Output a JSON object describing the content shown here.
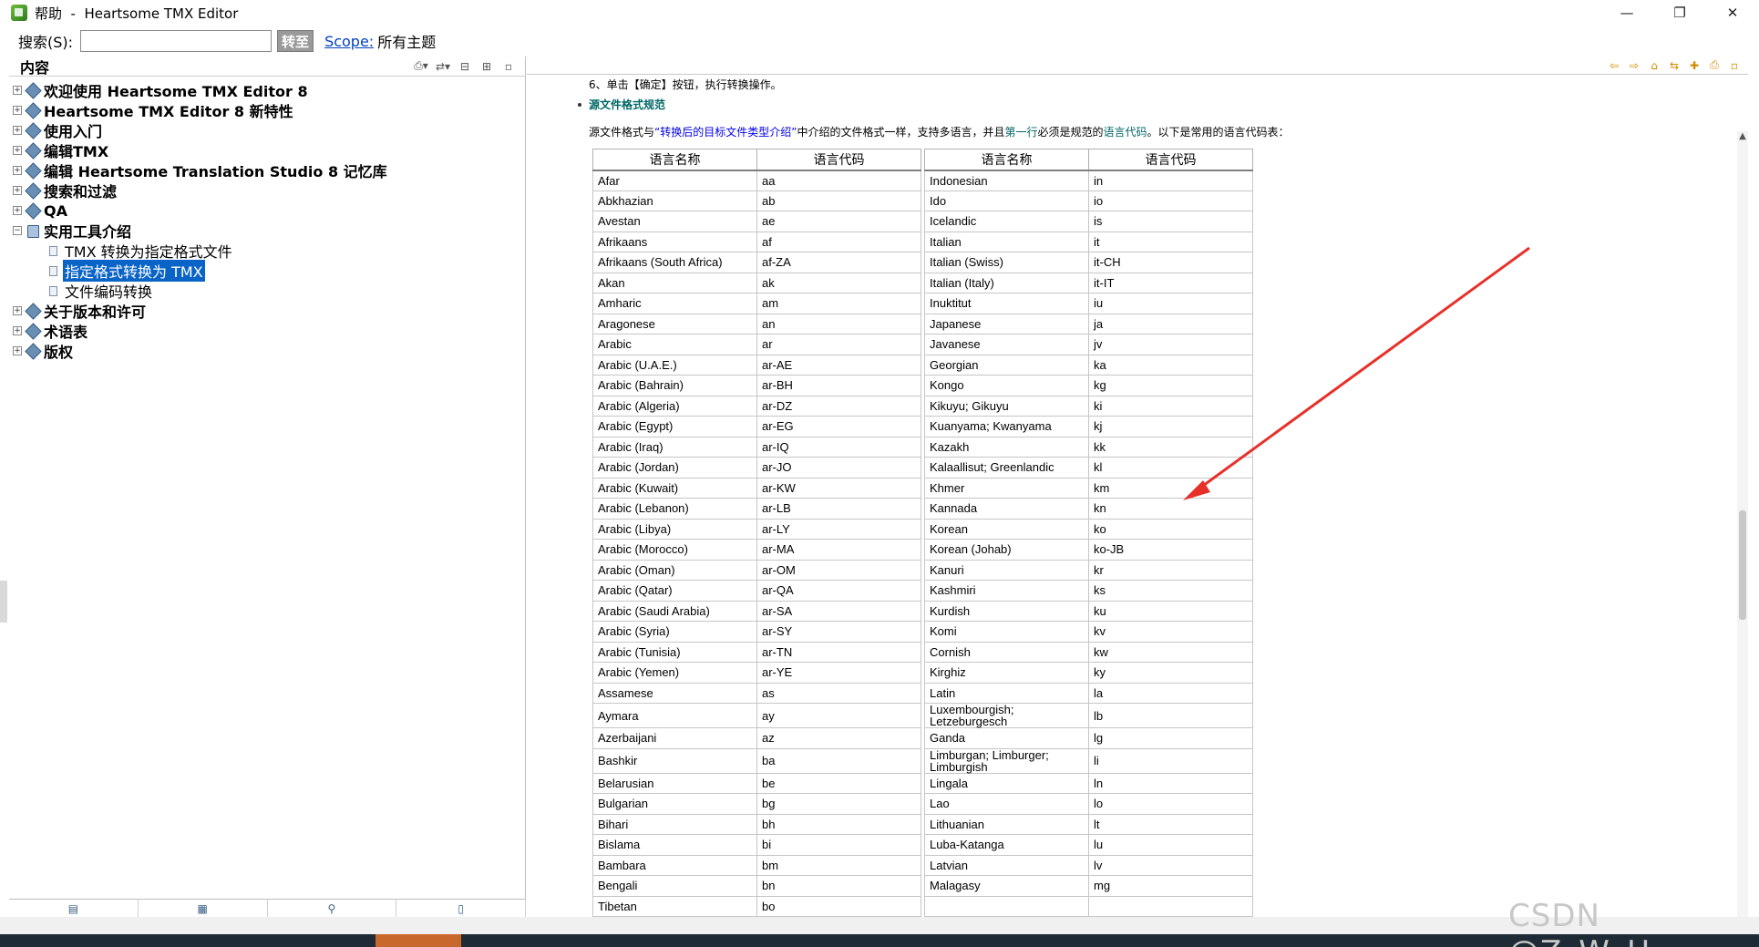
{
  "window": {
    "title": "帮助  -  Heartsome TMX Editor",
    "minimize": "—",
    "restore": "❐",
    "close": "✕"
  },
  "search": {
    "label": "搜索(S):",
    "value": "",
    "goto_label": "转至",
    "scope_link": "Scope:",
    "scope_value": "所有主题"
  },
  "left_panel": {
    "title": "内容",
    "tree": [
      {
        "label": "欢迎使用 Heartsome TMX Editor 8",
        "expander": "+"
      },
      {
        "label": "Heartsome TMX Editor 8 新特性",
        "expander": "+"
      },
      {
        "label": "使用入门",
        "expander": "+"
      },
      {
        "label": "编辑TMX",
        "expander": "+"
      },
      {
        "label": "编辑 Heartsome Translation Studio 8 记忆库",
        "expander": "+"
      },
      {
        "label": "搜索和过滤",
        "expander": "+"
      },
      {
        "label": "QA",
        "expander": "+"
      },
      {
        "label": "实用工具介绍",
        "expander": "−"
      }
    ],
    "children": [
      {
        "label": "TMX 转换为指定格式文件"
      },
      {
        "label": "指定格式转换为 TMX"
      },
      {
        "label": "文件编码转换"
      }
    ],
    "tree_after": [
      {
        "label": "关于版本和许可",
        "expander": "+"
      },
      {
        "label": "术语表",
        "expander": "+"
      },
      {
        "label": "版权",
        "expander": "+"
      }
    ]
  },
  "content": {
    "step_text": "6、单击【确定】按钮，执行转换操作。",
    "section_title": "源文件格式规范",
    "intro_part1": "源文件格式与",
    "intro_link": "“转换后的目标文件类型介绍”",
    "intro_part2": "中介绍的文件格式一样，支持多语言，并且",
    "intro_first_row": "第一行",
    "intro_part3": "必须是规范的",
    "intro_lang_code": "语言代码",
    "intro_part4": "。以下是常用的语言代码表：",
    "headers": [
      "语言名称",
      "语言代码",
      "语言名称",
      "语言代码"
    ],
    "rows": [
      [
        "Afar",
        "aa",
        "Indonesian",
        "in"
      ],
      [
        "Abkhazian",
        "ab",
        "Ido",
        "io"
      ],
      [
        "Avestan",
        "ae",
        "Icelandic",
        "is"
      ],
      [
        "Afrikaans",
        "af",
        "Italian",
        "it"
      ],
      [
        "Afrikaans (South Africa)",
        "af-ZA",
        "Italian (Swiss)",
        "it-CH"
      ],
      [
        "Akan",
        "ak",
        "Italian (Italy)",
        "it-IT"
      ],
      [
        "Amharic",
        "am",
        "Inuktitut",
        "iu"
      ],
      [
        "Aragonese",
        "an",
        "Japanese",
        "ja"
      ],
      [
        "Arabic",
        "ar",
        "Javanese",
        "jv"
      ],
      [
        "Arabic (U.A.E.)",
        "ar-AE",
        "Georgian",
        "ka"
      ],
      [
        "Arabic (Bahrain)",
        "ar-BH",
        "Kongo",
        "kg"
      ],
      [
        "Arabic (Algeria)",
        "ar-DZ",
        "Kikuyu; Gikuyu",
        "ki"
      ],
      [
        "Arabic (Egypt)",
        "ar-EG",
        "Kuanyama; Kwanyama",
        "kj"
      ],
      [
        "Arabic (Iraq)",
        "ar-IQ",
        "Kazakh",
        "kk"
      ],
      [
        "Arabic (Jordan)",
        "ar-JO",
        "Kalaallisut; Greenlandic",
        "kl"
      ],
      [
        "Arabic (Kuwait)",
        "ar-KW",
        "Khmer",
        "km"
      ],
      [
        "Arabic (Lebanon)",
        "ar-LB",
        "Kannada",
        "kn"
      ],
      [
        "Arabic (Libya)",
        "ar-LY",
        "Korean",
        "ko"
      ],
      [
        "Arabic (Morocco)",
        "ar-MA",
        "Korean (Johab)",
        "ko-JB"
      ],
      [
        "Arabic (Oman)",
        "ar-OM",
        "Kanuri",
        "kr"
      ],
      [
        "Arabic (Qatar)",
        "ar-QA",
        "Kashmiri",
        "ks"
      ],
      [
        "Arabic (Saudi Arabia)",
        "ar-SA",
        "Kurdish",
        "ku"
      ],
      [
        "Arabic (Syria)",
        "ar-SY",
        "Komi",
        "kv"
      ],
      [
        "Arabic (Tunisia)",
        "ar-TN",
        "Cornish",
        "kw"
      ],
      [
        "Arabic (Yemen)",
        "ar-YE",
        "Kirghiz",
        "ky"
      ],
      [
        "Assamese",
        "as",
        "Latin",
        "la"
      ],
      [
        "Aymara",
        "ay",
        "Luxembourgish; Letzeburgesch",
        "lb"
      ],
      [
        "Azerbaijani",
        "az",
        "Ganda",
        "lg"
      ],
      [
        "Bashkir",
        "ba",
        "Limburgan; Limburger; Limburgish",
        "li"
      ],
      [
        "Belarusian",
        "be",
        "Lingala",
        "ln"
      ],
      [
        "Bulgarian",
        "bg",
        "Lao",
        "lo"
      ],
      [
        "Bihari",
        "bh",
        "Lithuanian",
        "lt"
      ],
      [
        "Bislama",
        "bi",
        "Luba-Katanga",
        "lu"
      ],
      [
        "Bambara",
        "bm",
        "Latvian",
        "lv"
      ],
      [
        "Bengali",
        "bn",
        "Malagasy",
        "mg"
      ],
      [
        "Tibetan",
        "bo",
        "",
        ""
      ]
    ]
  },
  "watermark": "CSDN @Z_W_H_",
  "colors": {
    "selection": "#0a64c8",
    "section_title": "#006666",
    "link": "#0000ee",
    "arrow": "#e8302a"
  }
}
